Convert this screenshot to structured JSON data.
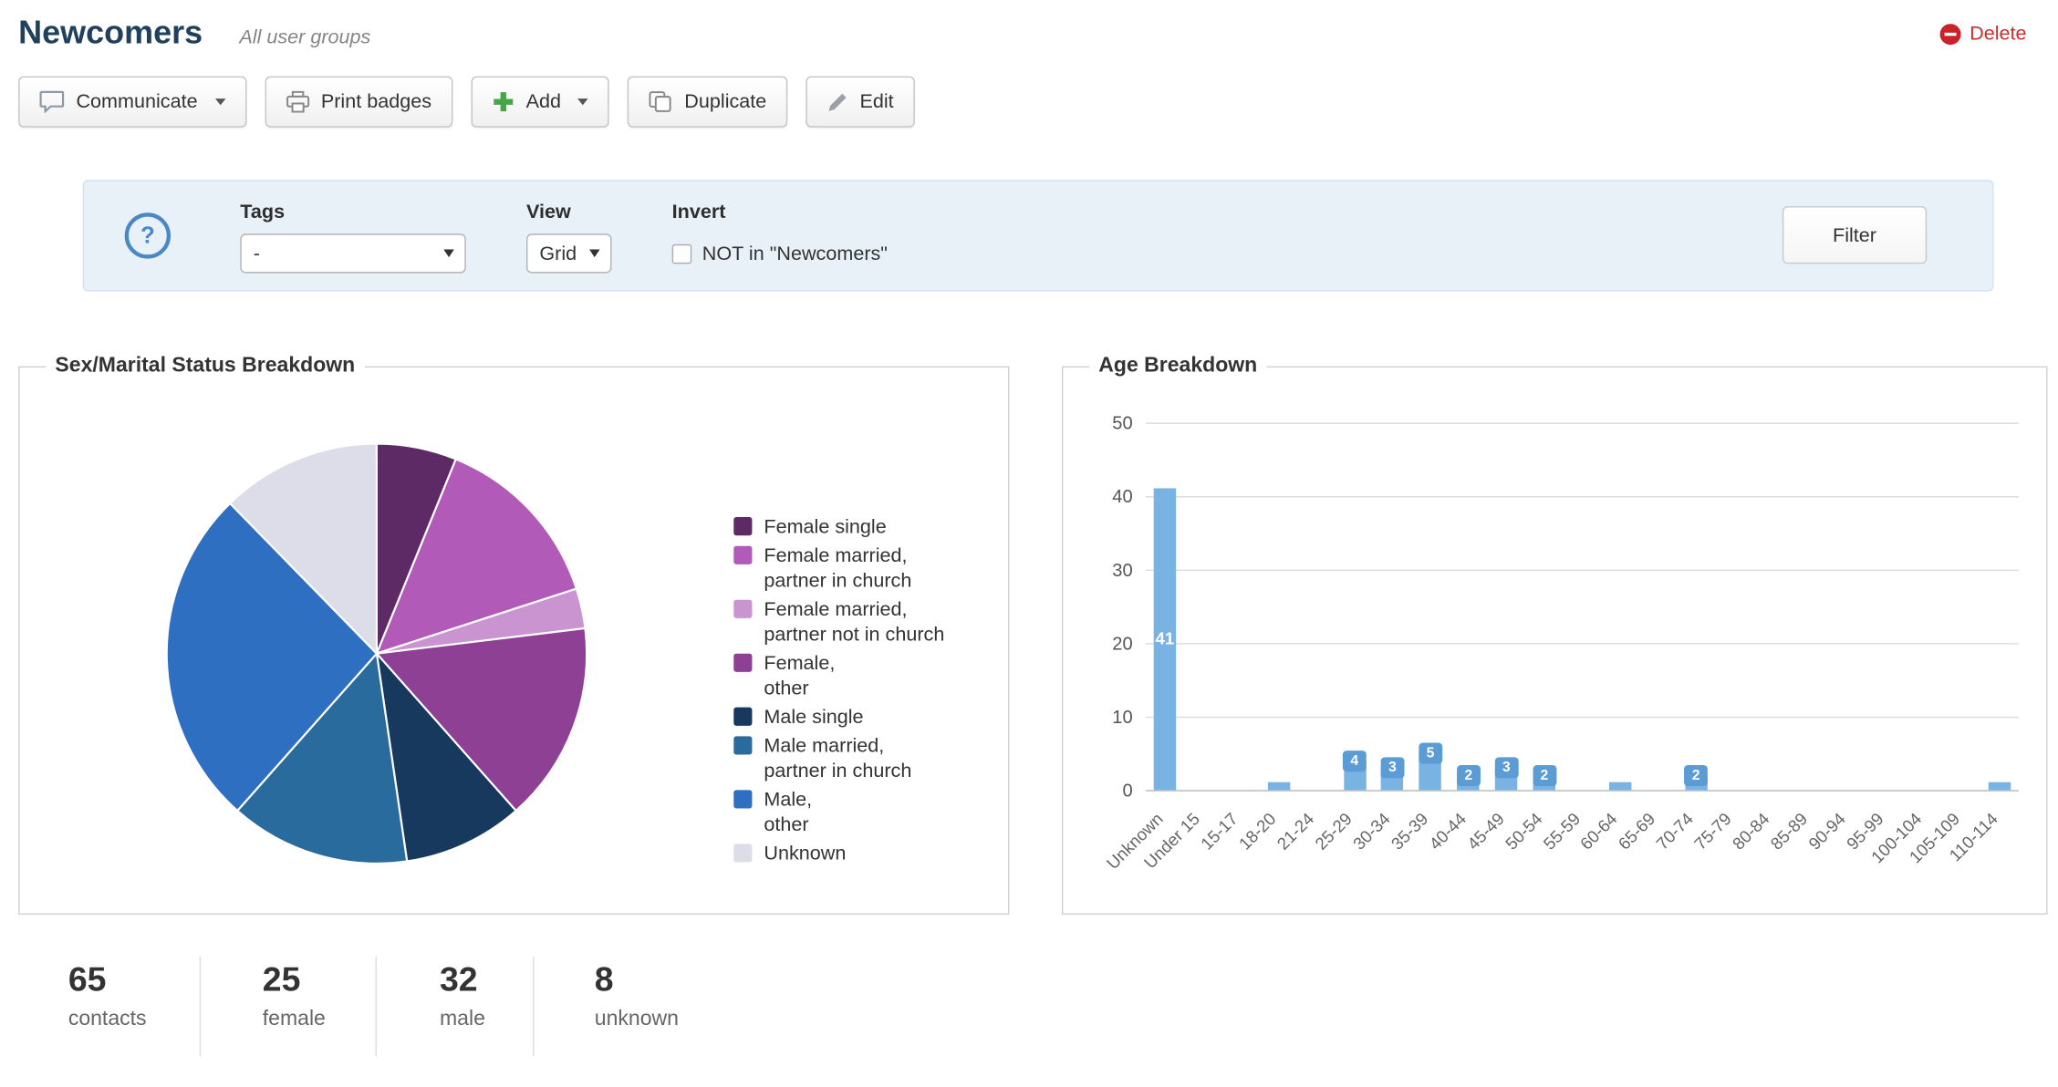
{
  "header": {
    "title": "Newcomers",
    "subtitle": "All user groups",
    "delete_label": "Delete",
    "delete_color": "#c9302c"
  },
  "toolbar": {
    "buttons": [
      {
        "label": "Communicate",
        "icon": "chat-bubble-icon",
        "has_caret": true
      },
      {
        "label": "Print badges",
        "icon": "printer-icon",
        "has_caret": false
      },
      {
        "label": "Add",
        "icon": "plus-icon",
        "has_caret": true
      },
      {
        "label": "Duplicate",
        "icon": "copy-icon",
        "has_caret": false
      },
      {
        "label": "Edit",
        "icon": "pencil-icon",
        "has_caret": false
      }
    ]
  },
  "filter_bar": {
    "help_symbol": "?",
    "tags_label": "Tags",
    "tags_value": "-",
    "view_label": "View",
    "view_value": "Grid",
    "invert_label": "Invert",
    "invert_option": "NOT in \"Newcomers\"",
    "invert_checked": false,
    "filter_button": "Filter"
  },
  "stats": [
    {
      "value": "65",
      "label": "contacts"
    },
    {
      "value": "25",
      "label": "female"
    },
    {
      "value": "32",
      "label": "male"
    },
    {
      "value": "8",
      "label": "unknown"
    }
  ],
  "chart_data": [
    {
      "type": "pie",
      "title": "Sex/Marital Status Breakdown",
      "legend_position": "right",
      "start_angle": "top-clockwise",
      "total": 65,
      "slices": [
        {
          "label": "Female single",
          "value": 4,
          "color": "#5d2a66"
        },
        {
          "label": "Female married,\npartner in church",
          "value": 9,
          "color": "#b25ab8"
        },
        {
          "label": "Female married,\npartner not in church",
          "value": 2,
          "color": "#c994d0"
        },
        {
          "label": "Female,\nother",
          "value": 10,
          "color": "#8d4094"
        },
        {
          "label": "Male single",
          "value": 6,
          "color": "#17395e"
        },
        {
          "label": "Male married,\npartner in church",
          "value": 9,
          "color": "#2a6b9e"
        },
        {
          "label": "Male,\nother",
          "value": 17,
          "color": "#2f6fc1"
        },
        {
          "label": "Unknown",
          "value": 8,
          "color": "#dcdde9"
        }
      ]
    },
    {
      "type": "bar",
      "title": "Age Breakdown",
      "categories": [
        "Unknown",
        "Under 15",
        "15-17",
        "18-20",
        "21-24",
        "25-29",
        "30-34",
        "35-39",
        "40-44",
        "45-49",
        "50-54",
        "55-59",
        "60-64",
        "65-69",
        "70-74",
        "75-79",
        "80-84",
        "85-89",
        "90-94",
        "95-99",
        "100-104",
        "105-109",
        "110-114"
      ],
      "values": [
        41,
        0,
        0,
        1,
        0,
        4,
        3,
        5,
        2,
        3,
        2,
        0,
        1,
        0,
        2,
        0,
        0,
        0,
        0,
        0,
        0,
        0,
        1
      ],
      "ylim": [
        0,
        50
      ],
      "yticks": [
        0,
        10,
        20,
        30,
        40,
        50
      ],
      "grid": true,
      "legend": false,
      "bar_color": "#79b3e4",
      "label_chip_color": "#5b9cd4"
    }
  ]
}
